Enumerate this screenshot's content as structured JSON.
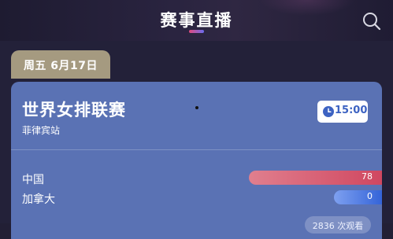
{
  "header": {
    "title": "赛事直播",
    "search_icon": "search-icon"
  },
  "date_tab": {
    "label": "周五  6月17日"
  },
  "match": {
    "league": "世界女排联赛",
    "station": "菲律宾站",
    "time": "15:00",
    "time_icon": "clock-icon",
    "teams": [
      {
        "name": "中国",
        "value": 78,
        "color": "#d04760"
      },
      {
        "name": "加拿大",
        "value": 0,
        "color": "#3464d8"
      }
    ],
    "watch_count": "2836 次观看"
  },
  "colors": {
    "accent_red": "#e24a7c",
    "accent_blue": "#6b6cf0",
    "card_bg": "#5a72b4",
    "date_tab_bg": "#a59a80"
  }
}
